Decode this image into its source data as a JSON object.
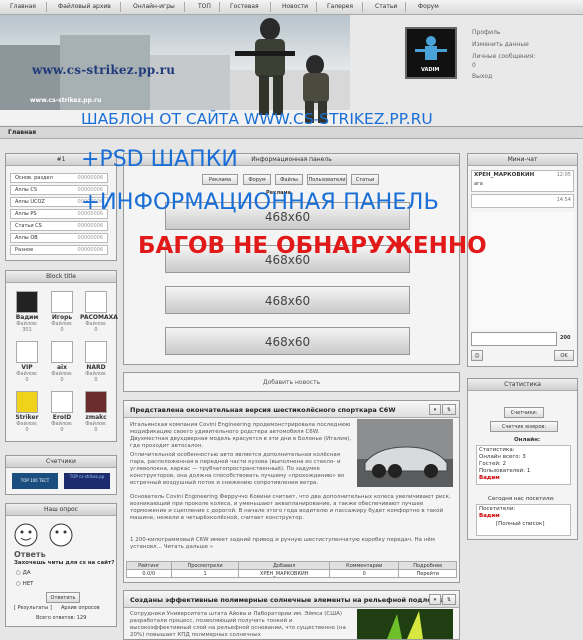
{
  "nav": [
    "Главная",
    "Файловый архив",
    "Онлайн-игры",
    "ТОП",
    "Гостевая",
    "Новости",
    "Галерея",
    "Статьи",
    "Форум"
  ],
  "banner": {
    "site": "www.cs-strikez.pp.ru",
    "site2": "www.cs-strikez.pp.ru"
  },
  "profile": {
    "avatar_name": "VADIM",
    "links": [
      "Профиль",
      "Изменить данные",
      "Личные сообщения:",
      "0",
      "Выход"
    ]
  },
  "breadcrumb": "Главная",
  "overlay": {
    "line1": "ШАБЛОН ОТ САЙТА WWW.CS-STRIKEZ.PP.RU",
    "line2": "+PSD ШАПКИ",
    "line3": "+ИНФОРМАЦИОННАЯ ПАНЕЛЬ",
    "line4": "БАГОВ НЕ ОБНАРУЖЕННО"
  },
  "menu": {
    "title": "#1",
    "items": [
      {
        "label": "Основ. раздел",
        "count": "00000006"
      },
      {
        "label": "Аллы CS",
        "count": "00000006"
      },
      {
        "label": "Аллы UCOZ",
        "count": "00000006"
      },
      {
        "label": "Аллы PS",
        "count": "00000006"
      },
      {
        "label": "Статьи CS",
        "count": "00000006"
      },
      {
        "label": "Аллы OB",
        "count": "00000006"
      },
      {
        "label": "Разное",
        "count": "00000006"
      }
    ]
  },
  "block": {
    "title": "Block title",
    "users": [
      {
        "name": "Вадим",
        "files": "Файлов:",
        "n": "301"
      },
      {
        "name": "Игорь",
        "files": "Файлов:",
        "n": "0"
      },
      {
        "name": "PACOMAXA",
        "files": "Файлов:",
        "n": "0"
      },
      {
        "name": "VIP",
        "files": "Файлов:",
        "n": "0"
      },
      {
        "name": "aix",
        "files": "Файлов:",
        "n": "0"
      },
      {
        "name": "NARD",
        "files": "Файлов:",
        "n": "0"
      },
      {
        "name": "Striker",
        "files": "Файлов:",
        "n": "0"
      },
      {
        "name": "EroID",
        "files": "Файлов:",
        "n": "0"
      },
      {
        "name": "zmakc",
        "files": "Файлов:",
        "n": "0"
      }
    ]
  },
  "counters": {
    "title": "Счетчики",
    "b1": "TOP 100 ТЕСТ",
    "b2": "TOP cs-strikez.pp"
  },
  "poll": {
    "title": "Наш опрос",
    "otvet": "Ответь",
    "question": "Захочешь читы для cs на сайт?",
    "options": [
      "ДА",
      "НЕТ"
    ],
    "button": "Ответить",
    "results": "Результаты",
    "archive": "Архив опросов",
    "total": "Всего ответов: 129"
  },
  "infopanel": {
    "title": "Информационная панель",
    "buttons": [
      "Реклама",
      "Форум",
      "Файлы",
      "Пользователи",
      "Статьи"
    ],
    "sub": "Реклама",
    "ads": [
      "468x60",
      "468x60",
      "468x60",
      "468x60"
    ]
  },
  "addnews": "Добавить новость",
  "news1": {
    "title": "Представлена окончательная версия шестиколёсного спорткара C6W",
    "p1": "Итальянская компания Covini Engineering продемонстрировала последнюю модификацию своего удивительного родстера автомобиля C6W. Двухместная двухдверная модель красуется в эти дни в Болонье (Италия), где проходит автосалон.",
    "p2": "Отличительной особенностью авто является дополнительная колёсная пара, расположенная в передней части кузова (выполнена из стекло- и углеволокна, каркас — трубчатопространственный). По задумке конструкторов, она должна способствовать лучшему «прохождению» во встречный воздушный поток и снижению сопротивления ветра.",
    "p3": "Основатель Covini Engineering Ферруччо Ковини считает, что два дополнительных колеса увеличивают риск, возникающий при проколе колеса, и уменьшают аквапланирование, а также обеспечивают лучшее торможение и сцепление с дорогой. В начале этого года водителю и пассажиру будет комфортно в такой машине, нежели в четырёхколёсной, считает конструктор.",
    "p4": "1 200-килограммовый C6W имеет задний привод и ручную шестиступенчатую коробку передач. На нём установл... Читать дальше »",
    "table": {
      "headers": [
        "Рейтинг",
        "Просмотрели",
        "Добавил",
        "Комментарии",
        "Подробнее"
      ],
      "values": [
        "0.0/0",
        "1",
        "ХРЕН_МАРКОВКИН",
        "0",
        "Перейти"
      ]
    }
  },
  "news2": {
    "title": "Созданы эффективные полимерные солнечные элементы на рельефной подложке",
    "p1": "Сотрудники Университета штата Айова и Лаборатории им. Эймса (США) разработали процесс, позволяющий получать тонкий и высокоэффективный слой на рельефной основании, что существенно (на 20%) повышает КПД полимерных солнечных"
  },
  "chat": {
    "title": "Мини-чат",
    "messages": [
      {
        "user": "ХРЕН_МАРКОВКИН",
        "time": "12:05",
        "text": "ага"
      },
      {
        "user": "",
        "time": "14:54",
        "text": ""
      }
    ],
    "counter": "200",
    "ok": "OK"
  },
  "stats": {
    "title": "Статистика",
    "counter_btn": "Счетчики:",
    "users_btn": "Счетчик юзеров:",
    "online_title": "Онлайн:",
    "stat_label": "Статистика:",
    "online_total": "Онлайн всего: 3",
    "guests": "Гостей: 2",
    "users": "Пользователей: 1",
    "online_user": "Вадим",
    "today_title": "Сегодня нас посетили:",
    "visitors_label": "Посетители:",
    "visitor": "Вадим",
    "full_list": "[Полный список]"
  },
  "colors": {
    "overlay_blue": "#1a6fd6",
    "overlay_red": "#e11919"
  }
}
